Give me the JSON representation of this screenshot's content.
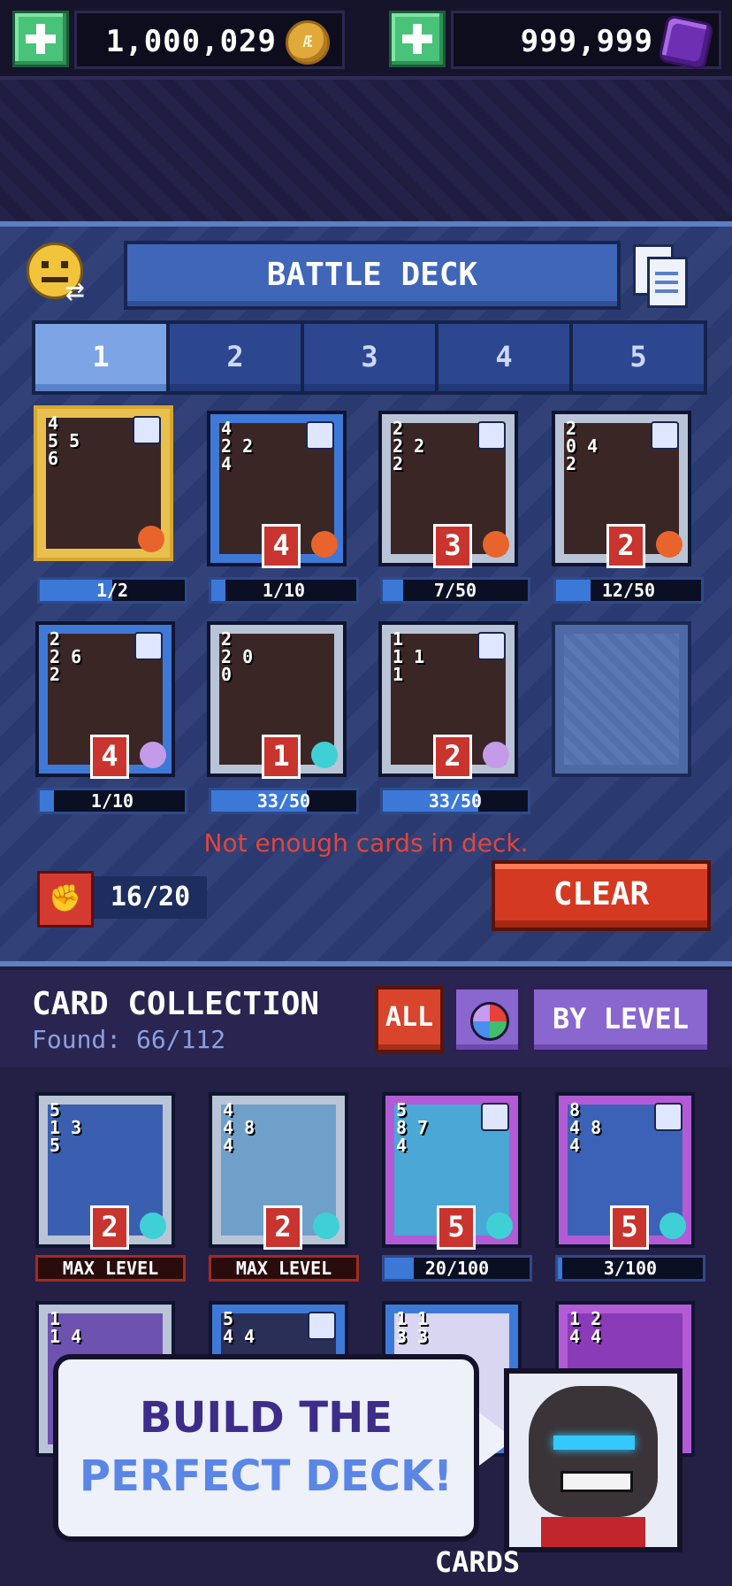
{
  "currency": {
    "coins": "1,000,029",
    "coin_symbol": "Æ",
    "gems": "999,999"
  },
  "battle_deck": {
    "title": "BATTLE DECK",
    "tabs": [
      "1",
      "2",
      "3",
      "4",
      "5"
    ],
    "active_tab": "1",
    "cards": [
      {
        "stats": "4\n5 5\n6",
        "cost": "",
        "progress": "1/2",
        "fill": 0.5,
        "frame": "gold",
        "element": "#e8642c"
      },
      {
        "stats": "4\n2 2\n4",
        "cost": "4",
        "progress": "1/10",
        "fill": 0.1,
        "frame": "blue",
        "element": "#e8642c"
      },
      {
        "stats": "2\n2 2\n2",
        "cost": "3",
        "progress": "7/50",
        "fill": 0.14,
        "frame": "silver",
        "element": "#e8642c"
      },
      {
        "stats": "2\n0 4\n2",
        "cost": "2",
        "progress": "12/50",
        "fill": 0.24,
        "frame": "silver",
        "element": "#e8642c"
      },
      {
        "stats": "2\n2 6\n2",
        "cost": "4",
        "progress": "1/10",
        "fill": 0.1,
        "frame": "blue",
        "element": "#c49be8"
      },
      {
        "stats": "2\n2 0\n0",
        "cost": "1",
        "progress": "33/50",
        "fill": 0.66,
        "frame": "silver",
        "element": "#3fd0d6"
      },
      {
        "stats": "1\n1 1\n1",
        "cost": "2",
        "progress": "33/50",
        "fill": 0.66,
        "frame": "silver",
        "element": "#c49be8"
      }
    ],
    "warning": "Not enough cards in deck.",
    "power": "16/20",
    "clear_label": "CLEAR"
  },
  "collection": {
    "title": "CARD COLLECTION",
    "found": "Found: 66/112",
    "filter_all": "ALL",
    "sort_label": "BY LEVEL",
    "cards": [
      {
        "stats": "5\n1 3\n5",
        "cost": "2",
        "progress": "MAX LEVEL",
        "max": true,
        "frame": "silver"
      },
      {
        "stats": "4\n4 8\n4",
        "cost": "2",
        "progress": "MAX LEVEL",
        "max": true,
        "frame": "silver"
      },
      {
        "stats": "5\n8 7\n4",
        "cost": "5",
        "progress": "20/100",
        "fill": 0.2,
        "max": false,
        "frame": "purple"
      },
      {
        "stats": "8\n4 8\n4",
        "cost": "5",
        "progress": "3/100",
        "fill": 0.03,
        "max": false,
        "frame": "purple"
      }
    ],
    "row2_stats": [
      "1\n1 4",
      "5\n4 4",
      "1 1\n3 3",
      "1 2\n4 4"
    ]
  },
  "promo": {
    "line1": "BUILD THE",
    "line2": "PERFECT DECK!"
  },
  "bottom_tab": "CARDS"
}
